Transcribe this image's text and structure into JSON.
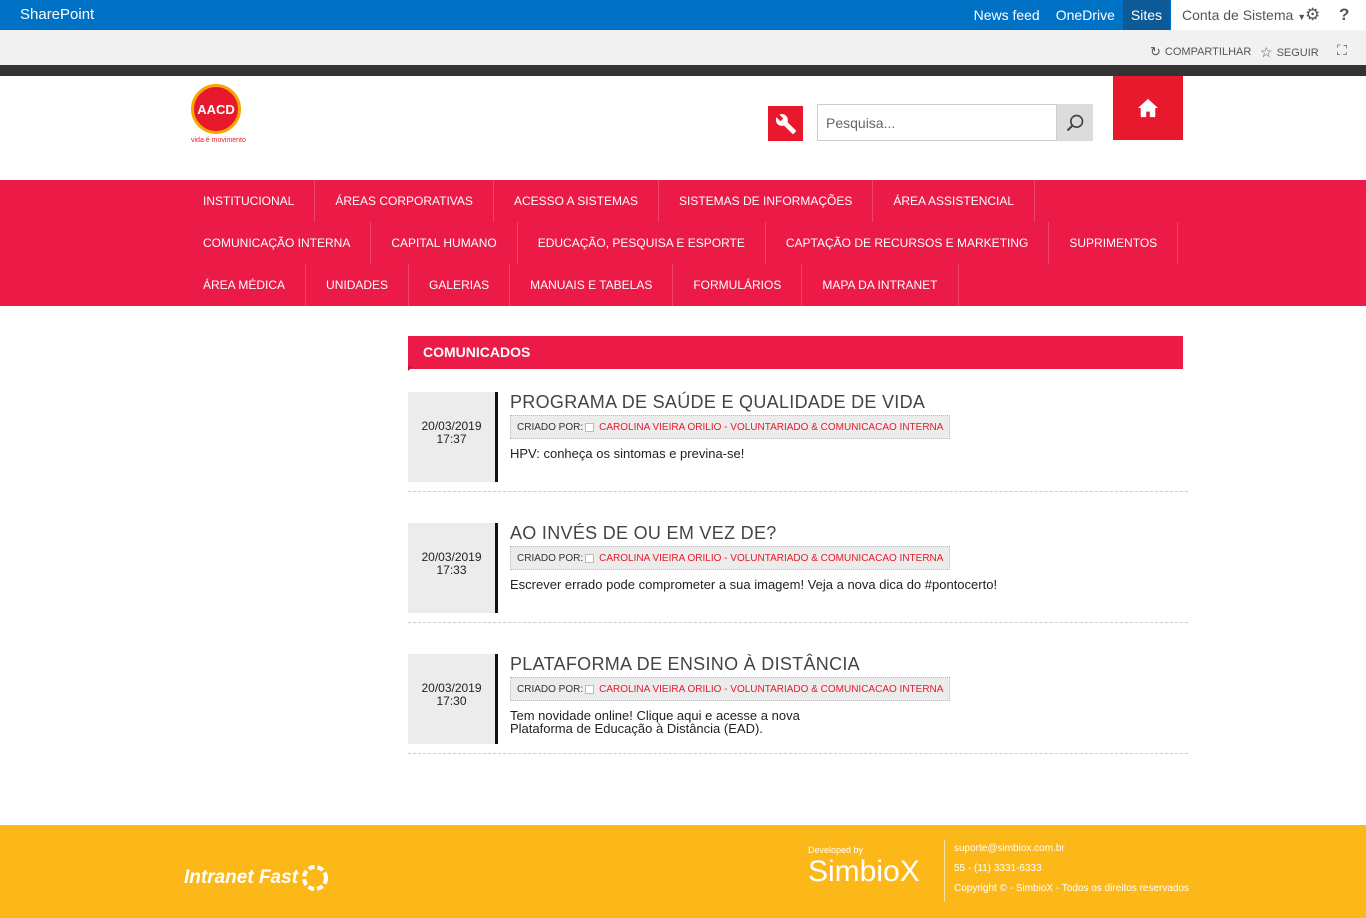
{
  "suitebar": {
    "brand": "SharePoint",
    "links": [
      "News feed",
      "OneDrive",
      "Sites"
    ],
    "account": "Conta de Sistema",
    "settings_icon": "gear-icon",
    "help_icon": "?"
  },
  "ribbon": {
    "share": "COMPARTILHAR",
    "follow": "SEGUIR"
  },
  "header": {
    "logo_text": "AACD",
    "logo_tagline": "vida é movimento",
    "search_placeholder": "Pesquisa..."
  },
  "nav": {
    "row1": [
      "INSTITUCIONAL",
      "ÁREAS CORPORATIVAS",
      "ACESSO A SISTEMAS",
      "SISTEMAS DE INFORMAÇÕES",
      "ÁREA ASSISTENCIAL"
    ],
    "row2": [
      "COMUNICAÇÃO INTERNA",
      "CAPITAL HUMANO",
      "EDUCAÇÃO, PESQUISA E ESPORTE",
      "CAPTAÇÃO DE RECURSOS E MARKETING",
      "SUPRIMENTOS"
    ],
    "row3": [
      "ÁREA MÉDICA",
      "UNIDADES",
      "GALERIAS",
      "MANUAIS E TABELAS",
      "FORMULÁRIOS",
      "MAPA DA INTRANET"
    ]
  },
  "section": {
    "title": "COMUNICADOS"
  },
  "news": [
    {
      "date": "20/03/2019",
      "time": "17:37",
      "title": "PROGRAMA DE SAÚDE E QUALIDADE DE VIDA",
      "created_by_label": "CRIADO POR:",
      "author": "CAROLINA VIEIRA ORILIO - VOLUNTARIADO & COMUNICACAO INTERNA",
      "desc": "HPV: conheça os sintomas e previna-se!"
    },
    {
      "date": "20/03/2019",
      "time": "17:33",
      "title": "AO INVÉS DE OU EM VEZ DE?",
      "created_by_label": "CRIADO POR:",
      "author": "CAROLINA VIEIRA ORILIO - VOLUNTARIADO & COMUNICACAO INTERNA",
      "desc": "Escrever errado pode comprometer a sua imagem! Veja a nova dica do #pontocerto!"
    },
    {
      "date": "20/03/2019",
      "time": "17:30",
      "title": "PLATAFORMA DE ENSINO À DISTÂNCIA",
      "created_by_label": "CRIADO POR:",
      "author": "CAROLINA VIEIRA ORILIO - VOLUNTARIADO & COMUNICACAO INTERNA",
      "desc": "Tem novidade online! Clique aqui e acesse a nova Plataforma de Educação à Distância (EAD)."
    }
  ],
  "footer": {
    "product": "Intranet Fast",
    "developed_by": "Developed by",
    "company": "SimbioX",
    "email": "suporte@simbiox.com.br",
    "phone": "55 - (11) 3331-6333",
    "copyright": "Copyright © - SimbioX - Todos os direitos reservados"
  },
  "colors": {
    "suitebar": "#0072c6",
    "accent": "#ec1a46",
    "footer": "#fbb818"
  }
}
